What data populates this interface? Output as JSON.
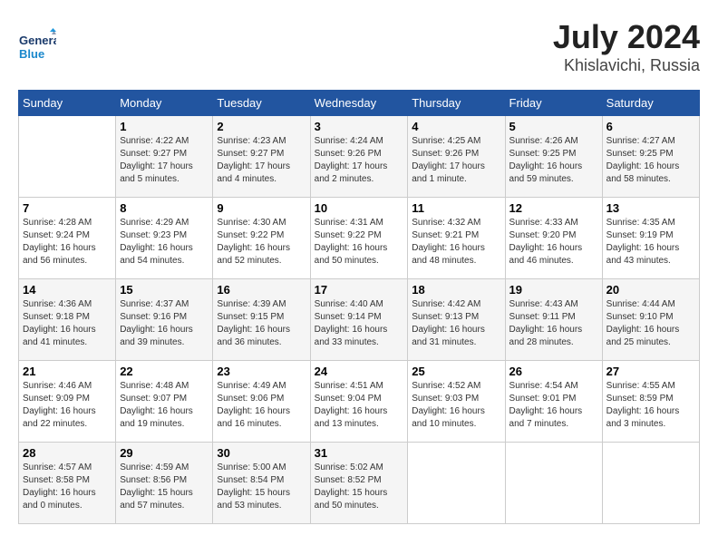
{
  "header": {
    "logo_line1": "General",
    "logo_line2": "Blue",
    "month": "July 2024",
    "location": "Khislavichi, Russia"
  },
  "weekdays": [
    "Sunday",
    "Monday",
    "Tuesday",
    "Wednesday",
    "Thursday",
    "Friday",
    "Saturday"
  ],
  "weeks": [
    [
      {
        "day": "",
        "info": ""
      },
      {
        "day": "1",
        "info": "Sunrise: 4:22 AM\nSunset: 9:27 PM\nDaylight: 17 hours\nand 5 minutes."
      },
      {
        "day": "2",
        "info": "Sunrise: 4:23 AM\nSunset: 9:27 PM\nDaylight: 17 hours\nand 4 minutes."
      },
      {
        "day": "3",
        "info": "Sunrise: 4:24 AM\nSunset: 9:26 PM\nDaylight: 17 hours\nand 2 minutes."
      },
      {
        "day": "4",
        "info": "Sunrise: 4:25 AM\nSunset: 9:26 PM\nDaylight: 17 hours\nand 1 minute."
      },
      {
        "day": "5",
        "info": "Sunrise: 4:26 AM\nSunset: 9:25 PM\nDaylight: 16 hours\nand 59 minutes."
      },
      {
        "day": "6",
        "info": "Sunrise: 4:27 AM\nSunset: 9:25 PM\nDaylight: 16 hours\nand 58 minutes."
      }
    ],
    [
      {
        "day": "7",
        "info": "Sunrise: 4:28 AM\nSunset: 9:24 PM\nDaylight: 16 hours\nand 56 minutes."
      },
      {
        "day": "8",
        "info": "Sunrise: 4:29 AM\nSunset: 9:23 PM\nDaylight: 16 hours\nand 54 minutes."
      },
      {
        "day": "9",
        "info": "Sunrise: 4:30 AM\nSunset: 9:22 PM\nDaylight: 16 hours\nand 52 minutes."
      },
      {
        "day": "10",
        "info": "Sunrise: 4:31 AM\nSunset: 9:22 PM\nDaylight: 16 hours\nand 50 minutes."
      },
      {
        "day": "11",
        "info": "Sunrise: 4:32 AM\nSunset: 9:21 PM\nDaylight: 16 hours\nand 48 minutes."
      },
      {
        "day": "12",
        "info": "Sunrise: 4:33 AM\nSunset: 9:20 PM\nDaylight: 16 hours\nand 46 minutes."
      },
      {
        "day": "13",
        "info": "Sunrise: 4:35 AM\nSunset: 9:19 PM\nDaylight: 16 hours\nand 43 minutes."
      }
    ],
    [
      {
        "day": "14",
        "info": "Sunrise: 4:36 AM\nSunset: 9:18 PM\nDaylight: 16 hours\nand 41 minutes."
      },
      {
        "day": "15",
        "info": "Sunrise: 4:37 AM\nSunset: 9:16 PM\nDaylight: 16 hours\nand 39 minutes."
      },
      {
        "day": "16",
        "info": "Sunrise: 4:39 AM\nSunset: 9:15 PM\nDaylight: 16 hours\nand 36 minutes."
      },
      {
        "day": "17",
        "info": "Sunrise: 4:40 AM\nSunset: 9:14 PM\nDaylight: 16 hours\nand 33 minutes."
      },
      {
        "day": "18",
        "info": "Sunrise: 4:42 AM\nSunset: 9:13 PM\nDaylight: 16 hours\nand 31 minutes."
      },
      {
        "day": "19",
        "info": "Sunrise: 4:43 AM\nSunset: 9:11 PM\nDaylight: 16 hours\nand 28 minutes."
      },
      {
        "day": "20",
        "info": "Sunrise: 4:44 AM\nSunset: 9:10 PM\nDaylight: 16 hours\nand 25 minutes."
      }
    ],
    [
      {
        "day": "21",
        "info": "Sunrise: 4:46 AM\nSunset: 9:09 PM\nDaylight: 16 hours\nand 22 minutes."
      },
      {
        "day": "22",
        "info": "Sunrise: 4:48 AM\nSunset: 9:07 PM\nDaylight: 16 hours\nand 19 minutes."
      },
      {
        "day": "23",
        "info": "Sunrise: 4:49 AM\nSunset: 9:06 PM\nDaylight: 16 hours\nand 16 minutes."
      },
      {
        "day": "24",
        "info": "Sunrise: 4:51 AM\nSunset: 9:04 PM\nDaylight: 16 hours\nand 13 minutes."
      },
      {
        "day": "25",
        "info": "Sunrise: 4:52 AM\nSunset: 9:03 PM\nDaylight: 16 hours\nand 10 minutes."
      },
      {
        "day": "26",
        "info": "Sunrise: 4:54 AM\nSunset: 9:01 PM\nDaylight: 16 hours\nand 7 minutes."
      },
      {
        "day": "27",
        "info": "Sunrise: 4:55 AM\nSunset: 8:59 PM\nDaylight: 16 hours\nand 3 minutes."
      }
    ],
    [
      {
        "day": "28",
        "info": "Sunrise: 4:57 AM\nSunset: 8:58 PM\nDaylight: 16 hours\nand 0 minutes."
      },
      {
        "day": "29",
        "info": "Sunrise: 4:59 AM\nSunset: 8:56 PM\nDaylight: 15 hours\nand 57 minutes."
      },
      {
        "day": "30",
        "info": "Sunrise: 5:00 AM\nSunset: 8:54 PM\nDaylight: 15 hours\nand 53 minutes."
      },
      {
        "day": "31",
        "info": "Sunrise: 5:02 AM\nSunset: 8:52 PM\nDaylight: 15 hours\nand 50 minutes."
      },
      {
        "day": "",
        "info": ""
      },
      {
        "day": "",
        "info": ""
      },
      {
        "day": "",
        "info": ""
      }
    ]
  ]
}
